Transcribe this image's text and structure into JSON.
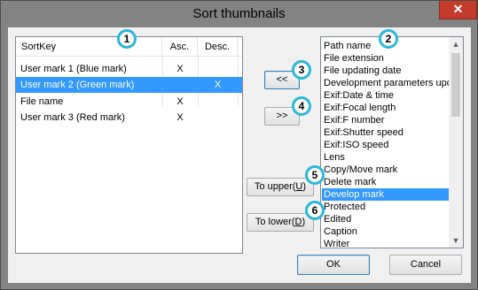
{
  "window": {
    "title": "Sort thumbnails",
    "close_icon": "✕"
  },
  "sortkey_list": {
    "columns": [
      "SortKey",
      "Asc.",
      "Desc."
    ],
    "rows": [
      {
        "key": "User mark 1 (Blue mark)",
        "asc": "X",
        "desc": ""
      },
      {
        "key": "User mark 2 (Green mark)",
        "asc": "",
        "desc": "X",
        "selected": true
      },
      {
        "key": "File name",
        "asc": "X",
        "desc": ""
      },
      {
        "key": "User mark 3 (Red mark)",
        "asc": "X",
        "desc": ""
      }
    ]
  },
  "buttons": {
    "add": "<<",
    "remove": ">>",
    "to_upper_prefix": "To upper(",
    "to_upper_key": "U",
    "to_upper_suffix": ")",
    "to_lower_prefix": "To lower(",
    "to_lower_key": "D",
    "to_lower_suffix": ")",
    "ok": "OK",
    "cancel": "Cancel"
  },
  "available_keys": {
    "items": [
      "Path name",
      "File extension",
      "File updating date",
      "Development parameters upd",
      "Exif:Date & time",
      "Exif:Focal length",
      "Exif:F number",
      "Exif:Shutter speed",
      "Exif:ISO speed",
      "Lens",
      "Copy/Move mark",
      "Delete mark",
      "Develop mark",
      "Protected",
      "Edited",
      "Caption",
      "Writer"
    ],
    "selected": "Develop mark",
    "scroll_up_icon": "▲",
    "scroll_down_icon": "▼"
  },
  "badges": [
    "1",
    "2",
    "3",
    "4",
    "5",
    "6"
  ],
  "colors": {
    "selection": "#3399ff",
    "badge_ring": "#2ab7d9",
    "close": "#c43b2c"
  }
}
